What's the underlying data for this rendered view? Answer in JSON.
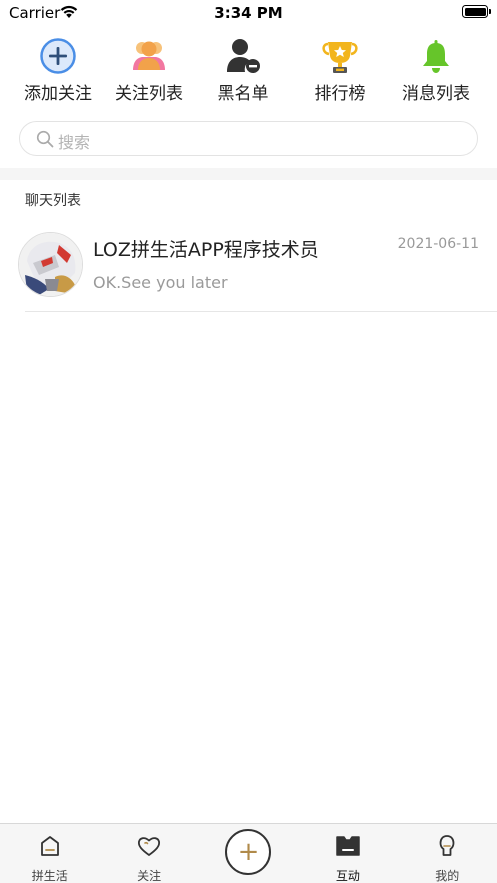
{
  "status_bar": {
    "carrier": "Carrier",
    "time": "3:34 PM"
  },
  "quick_menu": {
    "items": [
      {
        "label": "添加关注",
        "icon": "add-circle-icon",
        "color": "#4a8ee6"
      },
      {
        "label": "关注列表",
        "icon": "users-icon",
        "color": "#f2a24a"
      },
      {
        "label": "黑名单",
        "icon": "user-block-icon",
        "color": "#333333"
      },
      {
        "label": "排行榜",
        "icon": "trophy-icon",
        "color": "#f2b51d"
      },
      {
        "label": "消息列表",
        "icon": "bell-icon",
        "color": "#66c52a"
      }
    ]
  },
  "search": {
    "placeholder": "搜索"
  },
  "chat_list": {
    "title": "聊天列表",
    "items": [
      {
        "name": "LOZ拼生活APP程序技术员",
        "date": "2021-06-11",
        "preview": "OK.See you later"
      }
    ]
  },
  "tab_bar": {
    "items": [
      {
        "label": "拼生活",
        "icon": "home-icon"
      },
      {
        "label": "关注",
        "icon": "heart-icon"
      },
      {
        "label": "+",
        "icon": "add-icon"
      },
      {
        "label": "互动",
        "icon": "interaction-icon",
        "active": true
      },
      {
        "label": "我的",
        "icon": "profile-icon"
      }
    ],
    "accent_color": "#b08a4a"
  }
}
